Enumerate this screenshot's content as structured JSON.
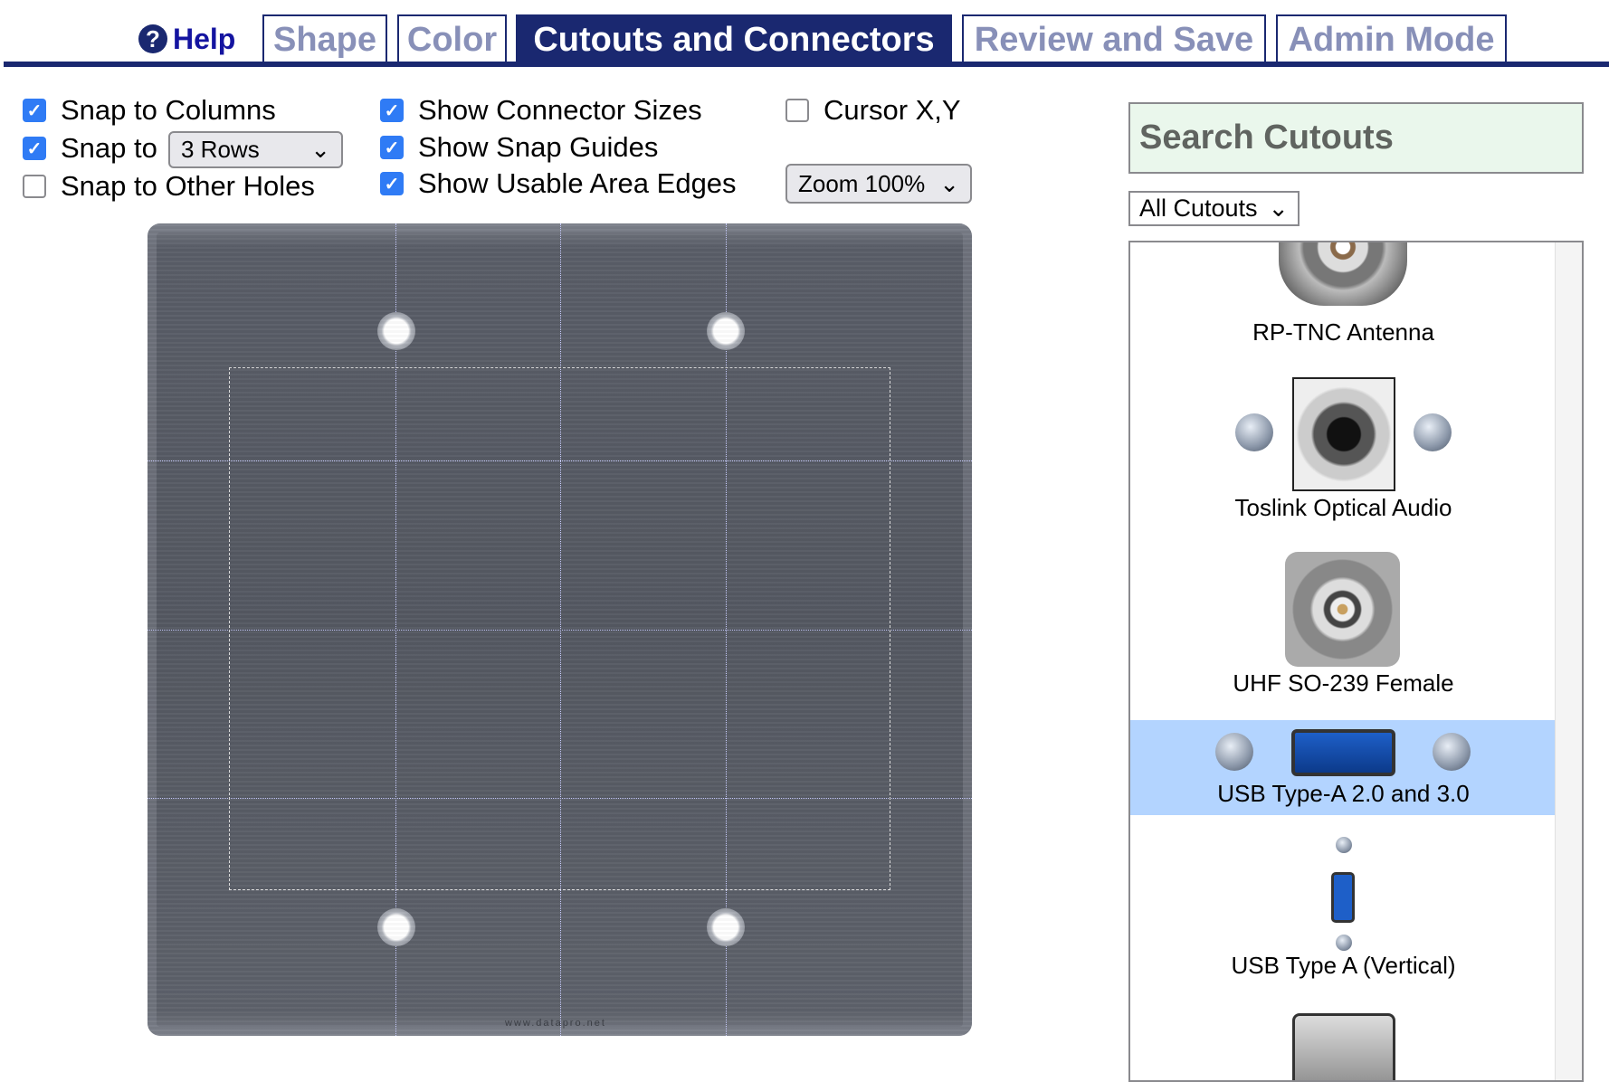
{
  "tabs": {
    "help": "Help",
    "items": [
      {
        "label": "Shape",
        "active": false
      },
      {
        "label": "Color",
        "active": false
      },
      {
        "label": "Cutouts and Connectors",
        "active": true
      },
      {
        "label": "Review and Save",
        "active": false
      },
      {
        "label": "Admin Mode",
        "active": false
      }
    ]
  },
  "options": {
    "snap_columns": {
      "label": "Snap to Columns",
      "checked": true
    },
    "snap_to": {
      "label": "Snap to",
      "checked": true,
      "value": "3 Rows"
    },
    "snap_holes": {
      "label": "Snap to Other Holes",
      "checked": false
    },
    "show_sizes": {
      "label": "Show Connector Sizes",
      "checked": true
    },
    "show_guides": {
      "label": "Show Snap Guides",
      "checked": true
    },
    "show_edges": {
      "label": "Show Usable Area Edges",
      "checked": true
    },
    "cursor_xy": {
      "label": "Cursor X,Y",
      "checked": false
    },
    "zoom": "Zoom 100%"
  },
  "plate": {
    "watermark": "www.datapro.net",
    "color": "#5a5e68"
  },
  "sidebar": {
    "search_placeholder": "Search Cutouts",
    "filter": "All Cutouts",
    "items": [
      {
        "label": "RP-TNC Antenna"
      },
      {
        "label": "Toslink Optical Audio"
      },
      {
        "label": "UHF SO-239 Female"
      },
      {
        "label": "USB Type-A 2.0 and 3.0",
        "selected": true
      },
      {
        "label": "USB Type A (Vertical)"
      }
    ]
  },
  "colors": {
    "accent": "#1a2870",
    "selected": "#b3d4ff",
    "checkbox": "#2f7bf5"
  }
}
